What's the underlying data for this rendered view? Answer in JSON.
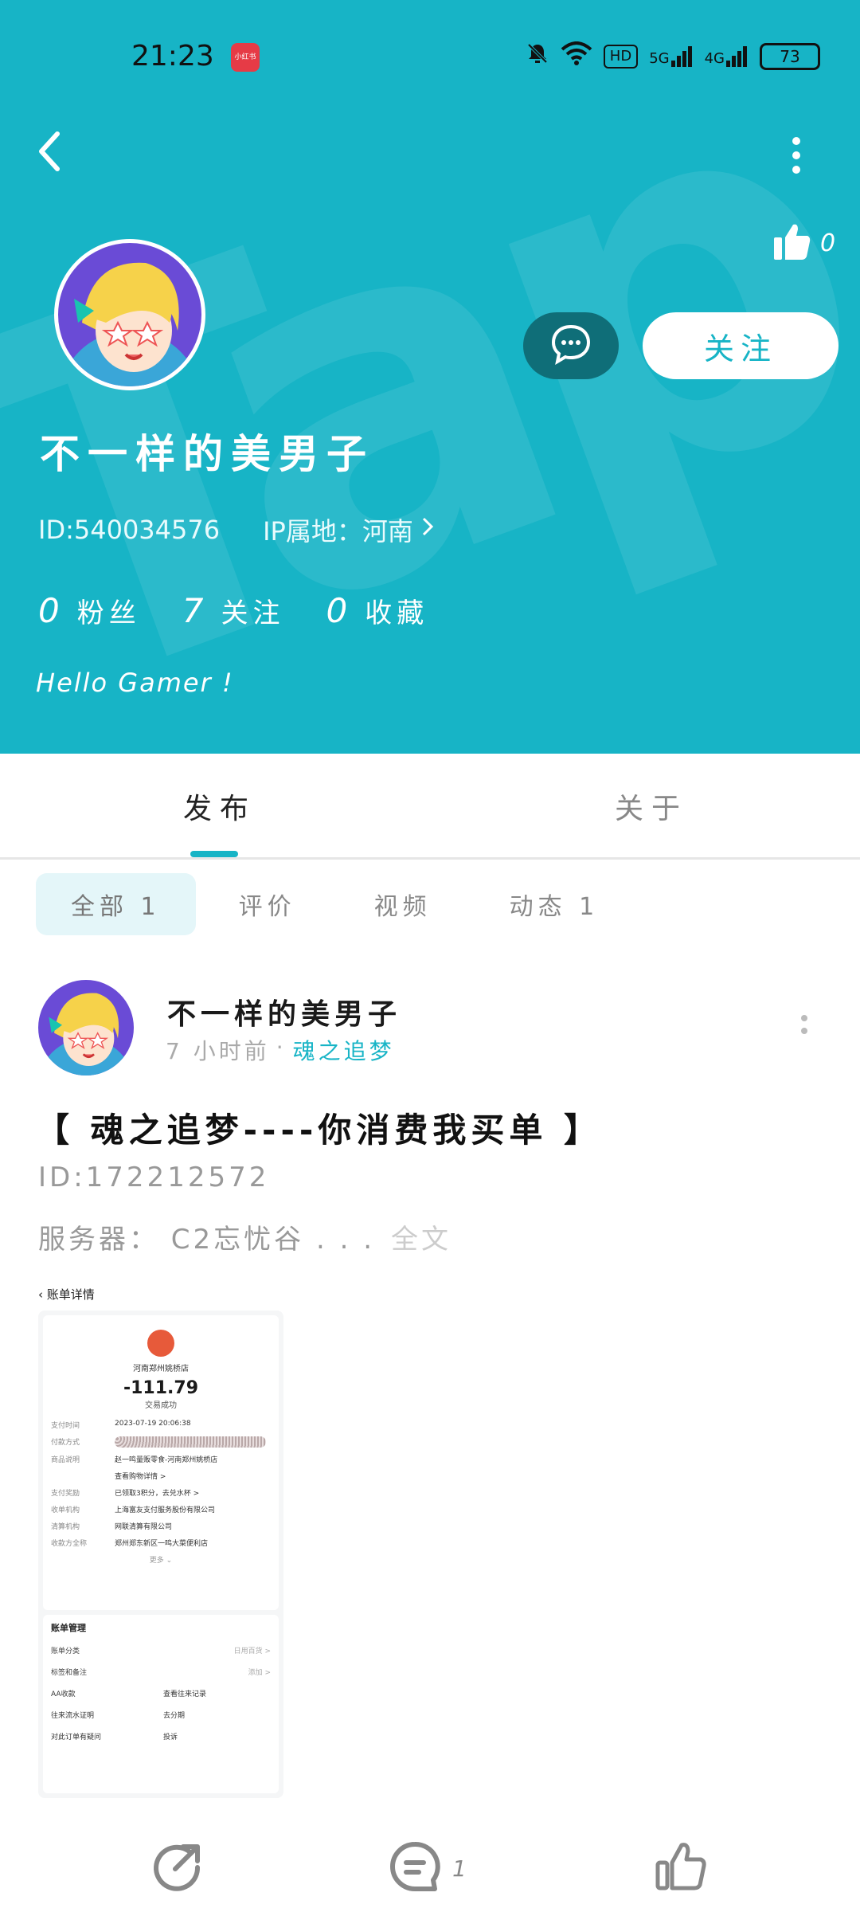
{
  "status_bar": {
    "time": "21:23",
    "app_badge": "小红书",
    "hd": "HD",
    "net1": "5G",
    "net2": "4G",
    "battery": "73"
  },
  "header": {
    "watermark": "Tap",
    "like_count": "0",
    "follow_label": "关注"
  },
  "profile": {
    "username": "不一样的美男子",
    "id": "ID:540034576",
    "ip": "IP属地：河南",
    "stats": [
      {
        "num": "0",
        "label": "粉丝"
      },
      {
        "num": "7",
        "label": "关注"
      },
      {
        "num": "0",
        "label": "收藏"
      }
    ],
    "bio": "Hello Gamer !"
  },
  "tabs": [
    "发布",
    "关于"
  ],
  "filters": [
    "全部 1",
    "评价",
    "视频",
    "动态 1"
  ],
  "post": {
    "author": "不一样的美男子",
    "time": "7 小时前",
    "dot": "·",
    "tag": "魂之追梦",
    "title": "【 魂之追梦----你消费我买单 】",
    "line1": "ID:172212572",
    "line2": "服务器： C2忘忧谷 . . .",
    "full_text": "全文",
    "comment_count": "1"
  },
  "receipt": {
    "back": "账单详情",
    "store": "河南郑州姚桥店",
    "amount": "-111.79",
    "status": "交易成功",
    "rows": [
      {
        "k": "支付时间",
        "v": "2023-07-19 20:06:38"
      },
      {
        "k": "付款方式",
        "v": ""
      },
      {
        "k": "商品说明",
        "v": "赵一鸣量贩零食-河南郑州姚桥店"
      },
      {
        "k": "",
        "v": "查看购物详情 >"
      },
      {
        "k": "支付奖励",
        "v": "已领取3积分，去兑水杯 >"
      },
      {
        "k": "收单机构",
        "v": "上海富友支付服务股份有限公司"
      },
      {
        "k": "清算机构",
        "v": "网联清算有限公司"
      },
      {
        "k": "收款方全称",
        "v": "郑州郑东新区一鸣大菜便利店"
      }
    ],
    "more": "更多 ⌄",
    "manage": "账单管理",
    "category": "账单分类",
    "category_v": "日用百货 >",
    "tags": "标签和备注",
    "tags_v": "添加 >",
    "grid": [
      "AA收款",
      "查看往来记录",
      "往来流水证明",
      "去分期",
      "对此订单有疑问",
      "投诉"
    ]
  },
  "colors": {
    "accent": "#17b4c6",
    "chat_bg": "#0f6e78"
  }
}
